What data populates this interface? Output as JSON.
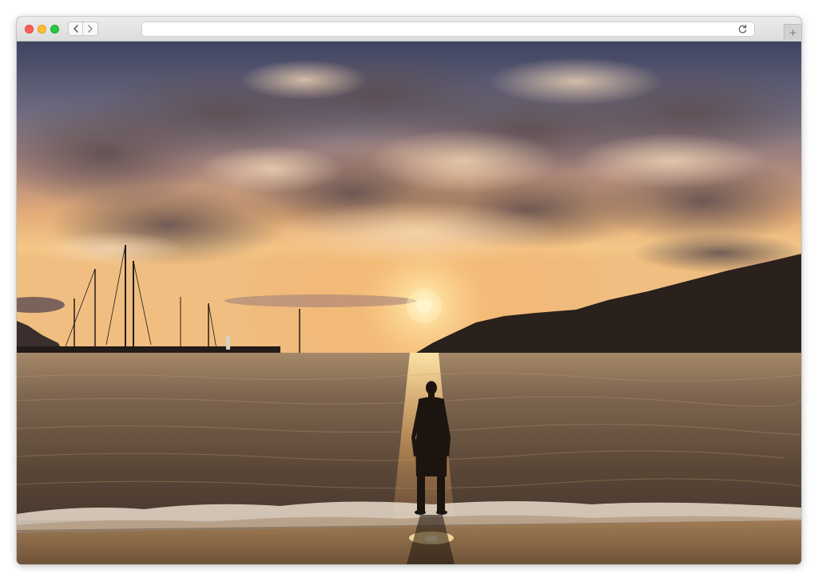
{
  "browser": {
    "address_text": "",
    "new_tab_symbol": "+"
  },
  "photo": {
    "subject": "sunset-over-bay-with-man-standing-on-beach"
  },
  "icons": [
    "chevron-left-icon",
    "chevron-right-icon",
    "reload-icon",
    "plus-icon"
  ],
  "colors": {
    "sun": "#fff3c0",
    "sky_top": "#4a4f66",
    "horizon": "#f2b46a",
    "sea": "#6b5443",
    "sand": "#8a6a48",
    "silhouette": "#1c140f"
  }
}
